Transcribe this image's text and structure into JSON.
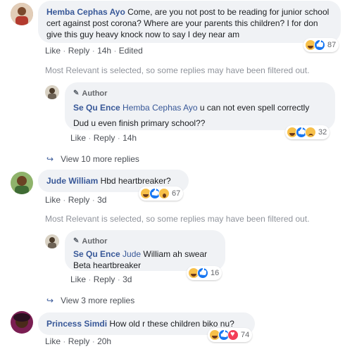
{
  "comments": [
    {
      "name": "Hemba Cephas Ayo",
      "text": "Come, are you not post to be reading for junior school cert against post corona? Where are your parents this children? I for don give this guy heavy knock now to say I dey near am",
      "actions": {
        "like": "Like",
        "reply": "Reply",
        "time": "14h",
        "edited": "Edited"
      },
      "reaction_count": "87",
      "filter_note": "Most Relevant is selected, so some replies may have been filtered out.",
      "reply": {
        "badge": "Author",
        "name": "Se Qu Ence",
        "tag": "Hemba Cephas Ayo",
        "text": "u can not even spell correctly",
        "text2": "Dud u even finish primary school??",
        "actions": {
          "like": "Like",
          "reply": "Reply",
          "time": "14h"
        },
        "reaction_count": "32"
      },
      "view_more": "View 10 more replies"
    },
    {
      "name": "Jude William",
      "text": "Hbd heartbreaker?",
      "actions": {
        "like": "Like",
        "reply": "Reply",
        "time": "3d"
      },
      "reaction_count": "67",
      "filter_note": "Most Relevant is selected, so some replies may have been filtered out.",
      "reply": {
        "badge": "Author",
        "name": "Se Qu Ence",
        "tag": "Jude",
        "text": "William ah swear",
        "text2": "Beta heartbreaker",
        "actions": {
          "like": "Like",
          "reply": "Reply",
          "time": "3d"
        },
        "reaction_count": "16"
      },
      "view_more": "View 3 more replies"
    },
    {
      "name": "Princess Simdi",
      "text": "How old r these children biko nu?",
      "actions": {
        "like": "Like",
        "reply": "Reply",
        "time": "20h"
      },
      "reaction_count": "74"
    }
  ],
  "separator": "·",
  "colors": {
    "link": "#385898",
    "bubble": "#f0f2f5",
    "muted": "#90949c"
  }
}
